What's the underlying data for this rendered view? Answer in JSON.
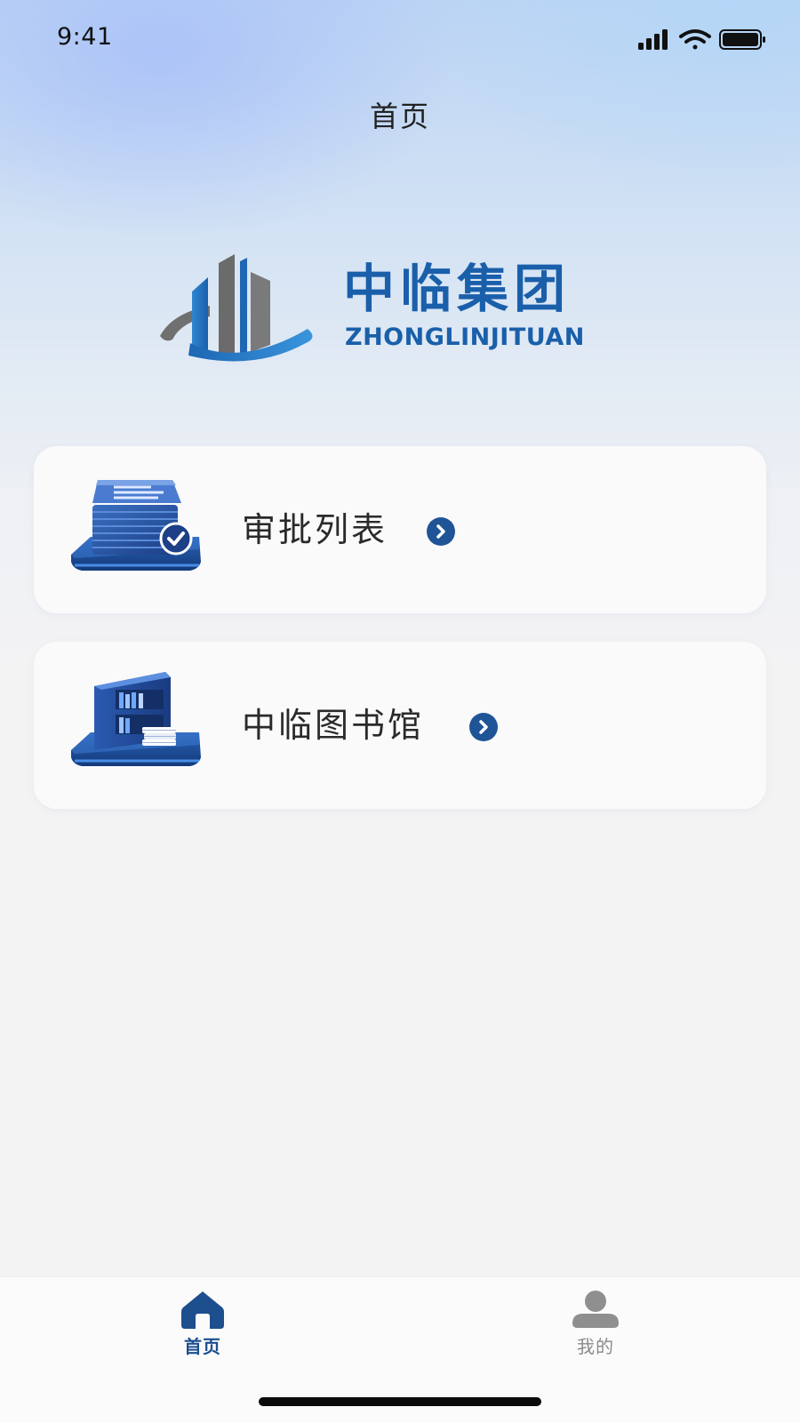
{
  "status_bar": {
    "time": "9:41",
    "icons": [
      "signal-icon",
      "wifi-icon",
      "battery-icon"
    ]
  },
  "nav": {
    "title": "首页"
  },
  "logo": {
    "name_cn": "中临集团",
    "name_en": "ZHONGLINJITUAN",
    "brand_color": "#1a5faa"
  },
  "cards": [
    {
      "label": "审批列表",
      "icon": "approval-documents-icon"
    },
    {
      "label": "中临图书馆",
      "icon": "bookshelf-library-icon"
    }
  ],
  "tabbar": {
    "items": [
      {
        "label": "首页",
        "icon": "home-icon",
        "active": true
      },
      {
        "label": "我的",
        "icon": "user-icon",
        "active": false
      }
    ],
    "active_color": "#1d4f8f",
    "inactive_color": "#8a8a8a"
  }
}
